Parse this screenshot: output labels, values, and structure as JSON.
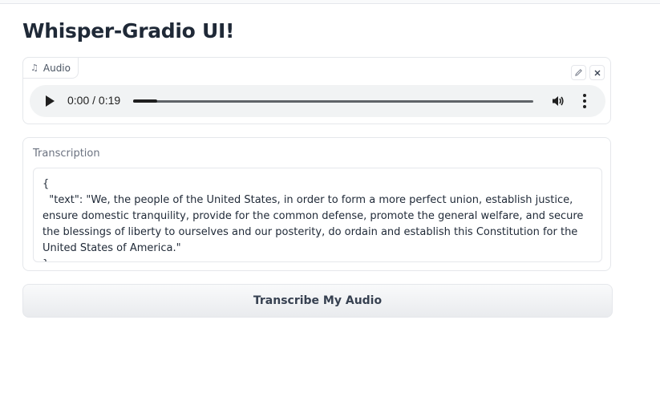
{
  "app": {
    "title": "Whisper-Gradio UI!"
  },
  "audio": {
    "label": "Audio",
    "label_icon": "music-note-icon",
    "edit_icon": "pencil-icon",
    "close_icon": "close-icon",
    "time_display": "0:00 / 0:19",
    "progress": 0.06,
    "volume_icon": "volume-icon",
    "more_icon": "more-vertical-icon"
  },
  "transcription": {
    "label": "Transcription",
    "text": "{\n  \"text\": \"We, the people of the United States, in order to form a more perfect union, establish justice, ensure domestic tranquility, provide for the common defense, promote the general welfare, and secure the blessings of liberty to ourselves and our posterity, do ordain and establish this Constitution for the United States of America.\"\n}"
  },
  "actions": {
    "submit_label": "Transcribe My Audio"
  },
  "colors": {
    "text": "#1f2937",
    "border": "#e5e7eb",
    "player_bg": "#f1f3f4"
  }
}
